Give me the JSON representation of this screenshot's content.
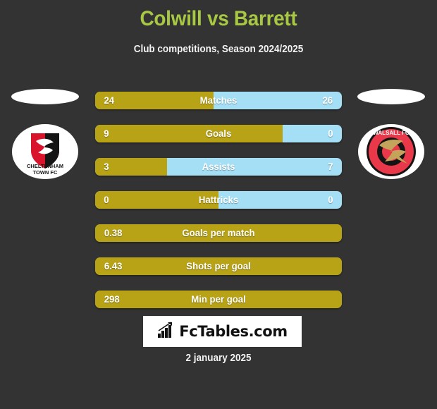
{
  "header": {
    "title": "Colwill vs Barrett",
    "subtitle": "Club competitions, Season 2024/2025",
    "title_color": "#a8c844"
  },
  "teams": {
    "home": {
      "crest_name": "cheltenham-town-fc-crest",
      "line1": "CHELTENHAM",
      "line2": "TOWN FC",
      "color": "#b8a216"
    },
    "away": {
      "crest_name": "walsall-fc-crest",
      "badge_text": "WALSALL FC",
      "color": "#a5dff5"
    }
  },
  "stats": [
    {
      "label": "Matches",
      "home": "24",
      "away": "26",
      "home_pct": 48,
      "show_away": true
    },
    {
      "label": "Goals",
      "home": "9",
      "away": "0",
      "home_pct": 76,
      "show_away": true
    },
    {
      "label": "Assists",
      "home": "3",
      "away": "7",
      "home_pct": 29,
      "show_away": true
    },
    {
      "label": "Hattricks",
      "home": "0",
      "away": "0",
      "home_pct": 50,
      "show_away": true
    },
    {
      "label": "Goals per match",
      "home": "0.38",
      "away": "",
      "home_pct": 100,
      "show_away": false
    },
    {
      "label": "Shots per goal",
      "home": "6.43",
      "away": "",
      "home_pct": 100,
      "show_away": false
    },
    {
      "label": "Min per goal",
      "home": "298",
      "away": "",
      "home_pct": 100,
      "show_away": false
    }
  ],
  "footer": {
    "brand": "FcTables.com",
    "brand_icon": "bar-chart-icon",
    "date": "2 january 2025"
  }
}
